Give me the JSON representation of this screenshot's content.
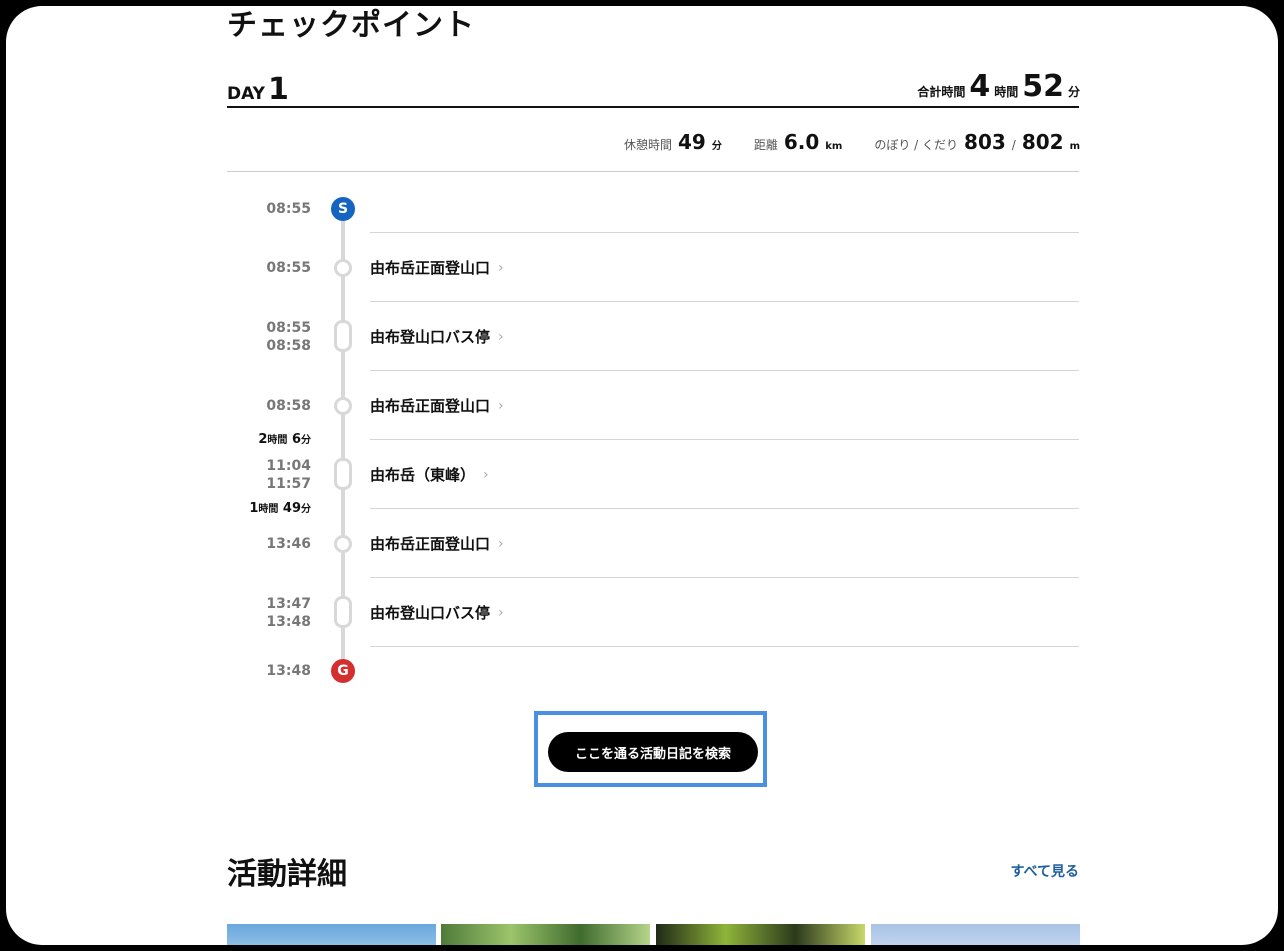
{
  "checkpoint": {
    "title": "チェックポイント",
    "day_prefix": "DAY",
    "day_number": "1",
    "total": {
      "label": "合計時間",
      "hours": "4",
      "hours_unit": "時間",
      "minutes": "52",
      "minutes_unit": "分"
    },
    "stats": {
      "rest_label": "休憩時間",
      "rest_value": "49",
      "rest_unit": "分",
      "distance_label": "距離",
      "distance_value": "6.0",
      "distance_unit": "km",
      "updown_label": "のぼり / くだり",
      "up_value": "803",
      "separator": "/",
      "down_value": "802",
      "updown_unit": "m"
    },
    "start_marker": "S",
    "goal_marker": "G",
    "points": [
      {
        "time": "08:55"
      },
      {
        "time": "08:55",
        "name": "由布岳正面登山口"
      },
      {
        "time_in": "08:55",
        "time_out": "08:58",
        "name": "由布登山口バス停"
      },
      {
        "time": "08:58",
        "name": "由布岳正面登山口"
      },
      {
        "time_in": "11:04",
        "time_out": "11:57",
        "name": "由布岳（東峰）"
      },
      {
        "time": "13:46",
        "name": "由布岳正面登山口"
      },
      {
        "time_in": "13:47",
        "time_out": "13:48",
        "name": "由布登山口バス停"
      },
      {
        "time": "13:48"
      }
    ],
    "durations": [
      {
        "hours": "2",
        "hours_unit": "時間",
        "minutes": "6",
        "minutes_unit": "分"
      },
      {
        "hours": "1",
        "hours_unit": "時間",
        "minutes": "49",
        "minutes_unit": "分"
      }
    ],
    "chevron": "›",
    "search_button": "ここを通る活動日記を検索"
  },
  "activity": {
    "title": "活動詳細",
    "see_all": "すべて見る"
  }
}
